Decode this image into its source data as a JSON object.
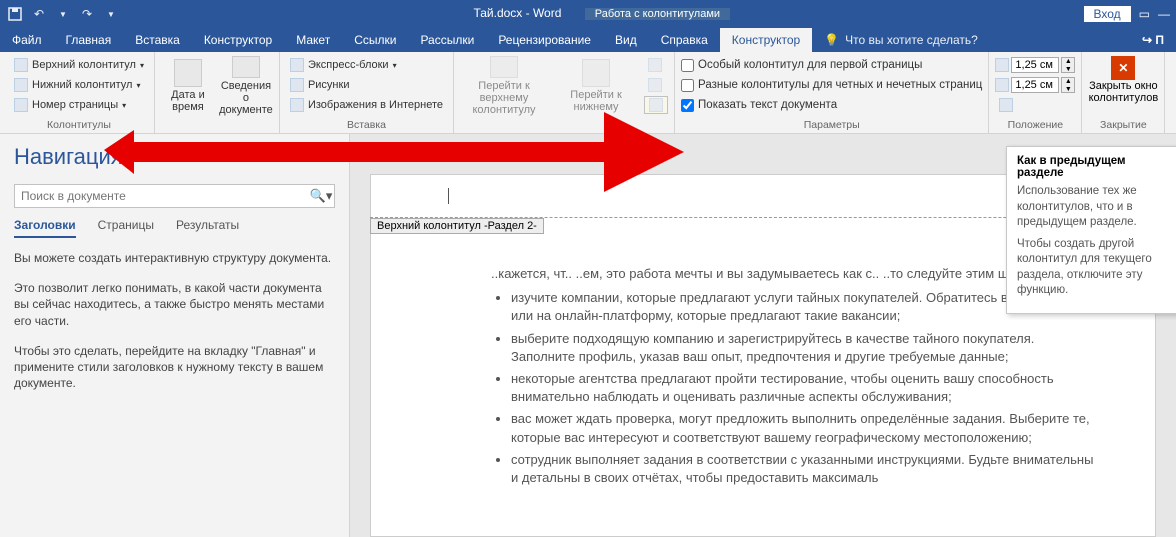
{
  "titlebar": {
    "doc": "Тай.docx  -  Word",
    "context_tab": "Работа с колонтитулами",
    "login": "Вход"
  },
  "tabs": [
    "Файл",
    "Главная",
    "Вставка",
    "Конструктор",
    "Макет",
    "Ссылки",
    "Рассылки",
    "Рецензирование",
    "Вид",
    "Справка",
    "Конструктор"
  ],
  "tellme": "Что вы хотите сделать?",
  "ribbon": {
    "g_colontitles": {
      "label": "Колонтитулы",
      "top": "Верхний колонтитул",
      "bottom": "Нижний колонтитул",
      "number": "Номер страницы"
    },
    "g_date": {
      "label_a": "Дата и",
      "label_b": "время",
      "label_c": "Сведения о",
      "label_d": "документе"
    },
    "g_insert": {
      "label": "Вставка",
      "express": "Экспресс-блоки",
      "pictures": "Рисунки",
      "online": "Изображения в Интернете"
    },
    "g_nav": {
      "go_top": "Перейти к верхнему",
      "go_top2": "колонтитулу",
      "go_next": "Перейти к нижнему"
    },
    "g_params": {
      "label": "Параметры",
      "first_page": "Особый колонтитул для первой страницы",
      "odd_even": "Разные колонтитулы для четных и нечетных страниц",
      "show_text": "Показать текст документа"
    },
    "g_position": {
      "label": "Положение",
      "val1": "1,25 см",
      "val2": "1,25 см"
    },
    "g_close": {
      "label": "Закрытие",
      "line1": "Закрыть окно",
      "line2": "колонтитулов"
    }
  },
  "navpane": {
    "title": "Навигация",
    "placeholder": "Поиск в документе",
    "tabs": [
      "Заголовки",
      "Страницы",
      "Результаты"
    ],
    "help": [
      "Вы можете создать интерактивную структуру документа.",
      "Это позволит легко понимать, в какой части документа вы сейчас находитесь, а также быстро менять местами его части.",
      "Чтобы это сделать, перейдите на вкладку \"Главная\" и примените стили заголовков к нужному тексту в вашем документе."
    ]
  },
  "page": {
    "hf_left": " Верхний колонтитул -Раздел 2- ",
    "hf_right": "Как в предыдущем",
    "frag_top": "..кажется, чт.. ..ем, это работа мечты и вы задумываетесь как с.. ..то следуйте этим шагам:",
    "bullets": [
      "изучите компании, которые предлагают услуги тайных покупателей. Обратитесь в агентство или на онлайн-платформу, которые предлагают такие вакансии;",
      "выберите подходящую компанию и зарегистрируйтесь в качестве тайного покупателя. Заполните профиль, указав ваш опыт, предпочтения и другие требуемые данные;",
      "некоторые агентства предлагают пройти тестирование, чтобы оценить вашу способность внимательно наблюдать и оценивать различные аспекты обслуживания;",
      "вас может ждать проверка, могут предложить выполнить определённые задания. Выберите те, которые вас интересуют и соответствуют вашему географическому местоположению;",
      "сотрудник выполняет задания в соответствии с указанными инструкциями. Будьте внимательны и детальны в своих отчётах, чтобы предоставить максималь"
    ]
  },
  "tooltip": {
    "title": "Как в предыдущем разделе",
    "body1": "Использование тех же колонтитулов, что и в предыдущем разделе.",
    "body2": "Чтобы создать другой колонтитул для текущего раздела, отключите эту функцию."
  }
}
